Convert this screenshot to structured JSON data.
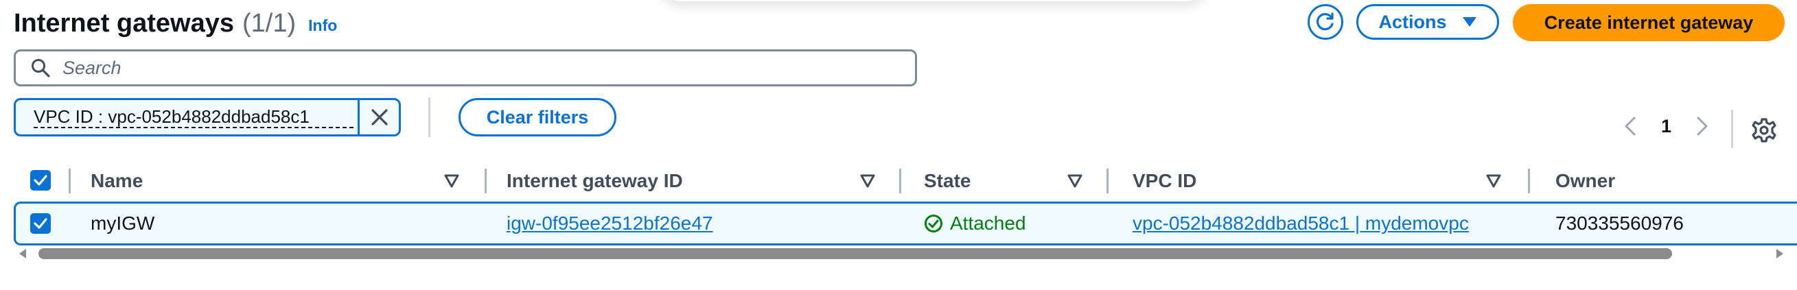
{
  "header": {
    "title": "Internet gateways",
    "count": "(1/1)",
    "info_link": "Info"
  },
  "toolbar": {
    "actions_label": "Actions",
    "create_label": "Create internet gateway"
  },
  "search": {
    "placeholder": "Search"
  },
  "filter_token": {
    "label": "VPC ID : vpc-052b4882ddbad58c1"
  },
  "clear_filters_label": "Clear filters",
  "pagination": {
    "current_page": "1"
  },
  "table": {
    "columns": [
      "Name",
      "Internet gateway ID",
      "State",
      "VPC ID",
      "Owner"
    ],
    "rows": [
      {
        "selected": true,
        "name": "myIGW",
        "igw_id": "igw-0f95ee2512bf26e47",
        "state": "Attached",
        "vpc_id": "vpc-052b4882ddbad58c1 | mydemovpc",
        "owner": "730335560976"
      }
    ]
  },
  "icons": {
    "refresh": "refresh-icon",
    "actions_caret": "caret-down-icon",
    "search": "search-icon",
    "remove_token": "close-icon",
    "prev_page": "chevron-left-icon",
    "next_page": "chevron-right-icon",
    "settings": "gear-icon",
    "sort": "sort-caret-icon",
    "state_ok": "status-success-icon"
  },
  "colors": {
    "accent": "#0972d3",
    "primary_button": "#ff9900",
    "success": "#037f0c",
    "selected_row_bg": "#f0fbff"
  }
}
